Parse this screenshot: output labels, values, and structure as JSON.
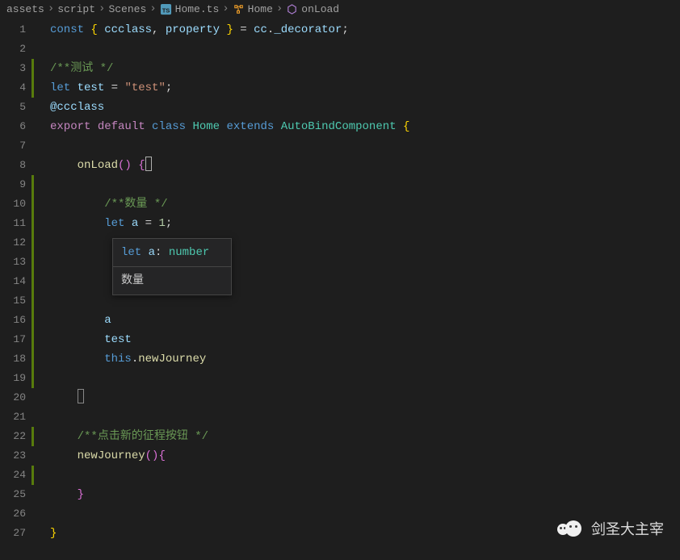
{
  "breadcrumb": {
    "items": [
      {
        "label": "assets"
      },
      {
        "label": "script"
      },
      {
        "label": "Scenes"
      },
      {
        "label": "Home.ts",
        "icon": "ts"
      },
      {
        "label": "Home",
        "icon": "class"
      },
      {
        "label": "onLoad",
        "icon": "method"
      }
    ]
  },
  "lines": {
    "count": 27,
    "modified": [
      3,
      4,
      9,
      10,
      11,
      12,
      13,
      14,
      15,
      16,
      17,
      18,
      19,
      22,
      24
    ]
  },
  "code": {
    "l1": {
      "const": "const",
      "ccclass": "ccclass",
      "property": "property",
      "cc": "cc",
      "_decorator": "_decorator"
    },
    "l3": {
      "comment": "/**测试 */"
    },
    "l4": {
      "let": "let",
      "test": "test",
      "equals": "=",
      "val": "\"test\"",
      "semi": ";"
    },
    "l5": {
      "decorator": "@ccclass"
    },
    "l6": {
      "export": "export",
      "default": "default",
      "class": "class",
      "Home": "Home",
      "extends": "extends",
      "AutoBindComponent": "AutoBindComponent"
    },
    "l8": {
      "onLoad": "onLoad"
    },
    "l10": {
      "comment": "/**数量 */"
    },
    "l11": {
      "let": "let",
      "a": "a",
      "equals": "=",
      "val": "1",
      "semi": ";"
    },
    "l16": {
      "a": "a"
    },
    "l17": {
      "test": "test"
    },
    "l18": {
      "this": "this",
      "newJourney": "newJourney"
    },
    "l22": {
      "comment": "/**点击新的征程按钮 */"
    },
    "l23": {
      "newJourney": "newJourney"
    }
  },
  "hover": {
    "let": "let",
    "a": "a",
    "colon": ": ",
    "type": "number",
    "doc": "数量"
  },
  "watermark": {
    "text": "剑圣大主宰"
  }
}
